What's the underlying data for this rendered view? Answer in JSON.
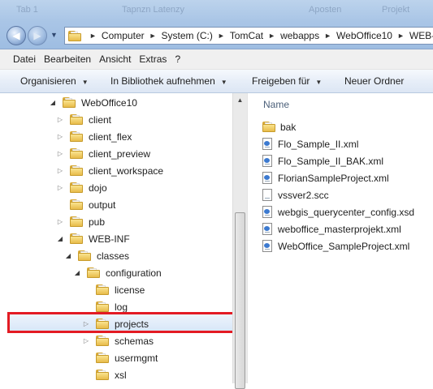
{
  "window": {
    "ghost_title_left": "Tab 1",
    "ghost_title_mid": "Tapnzn Latenzy",
    "ghost_title_right1": "Aposten",
    "ghost_title_right2": "Projekt",
    "address": [
      "Computer",
      "System (C:)",
      "TomCat",
      "webapps",
      "WebOffice10",
      "WEB-"
    ]
  },
  "menu": [
    "Datei",
    "Bearbeiten",
    "Ansicht",
    "Extras",
    "?"
  ],
  "commands": [
    {
      "label": "Organisieren",
      "dropdown": true
    },
    {
      "label": "In Bibliothek aufnehmen",
      "dropdown": true
    },
    {
      "label": "Freigeben für",
      "dropdown": true
    },
    {
      "label": "Neuer Ordner",
      "dropdown": false
    }
  ],
  "tree": [
    {
      "label": "WebOffice10",
      "expanded": true
    },
    {
      "label": "client",
      "expanded": false
    },
    {
      "label": "client_flex",
      "expanded": false
    },
    {
      "label": "client_preview",
      "expanded": false
    },
    {
      "label": "client_workspace",
      "expanded": false
    },
    {
      "label": "dojo",
      "expanded": false
    },
    {
      "label": "output",
      "expanded": null
    },
    {
      "label": "pub",
      "expanded": false
    },
    {
      "label": "WEB-INF",
      "expanded": true
    },
    {
      "label": "classes",
      "expanded": true
    },
    {
      "label": "configuration",
      "expanded": true
    },
    {
      "label": "license",
      "expanded": null
    },
    {
      "label": "log",
      "expanded": null
    },
    {
      "label": "projects",
      "expanded": false,
      "selected": true
    },
    {
      "label": "schemas",
      "expanded": false
    },
    {
      "label": "usermgmt",
      "expanded": null
    },
    {
      "label": "xsl",
      "expanded": null
    }
  ],
  "files_header": "Name",
  "files": [
    {
      "name": "bak",
      "type": "folder"
    },
    {
      "name": "Flo_Sample_II.xml",
      "type": "xml"
    },
    {
      "name": "Flo_Sample_II_BAK.xml",
      "type": "xml"
    },
    {
      "name": "FlorianSampleProject.xml",
      "type": "xml"
    },
    {
      "name": "vssver2.scc",
      "type": "plain"
    },
    {
      "name": "webgis_querycenter_config.xsd",
      "type": "xsd"
    },
    {
      "name": "weboffice_masterprojekt.xml",
      "type": "xml"
    },
    {
      "name": "WebOffice_SampleProject.xml",
      "type": "xml"
    }
  ],
  "colors": {
    "highlight": "#e31b23",
    "selection": "#d9e7f8"
  }
}
